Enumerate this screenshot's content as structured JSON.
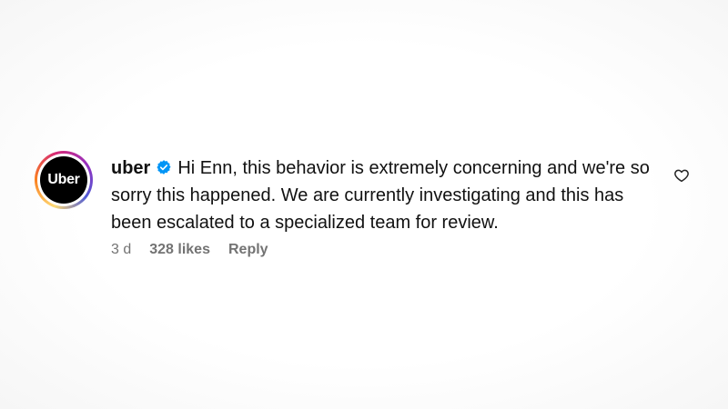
{
  "comment": {
    "avatar_text": "Uber",
    "username": "uber",
    "verified_icon": "verified-badge-icon",
    "body": "Hi Enn, this behavior is extremely concerning and we're so sorry this happened. We are currently investigating and this has been escalated to a specialized team for review.",
    "time_ago": "3 d",
    "likes": "328 likes",
    "reply_label": "Reply",
    "like_icon": "heart-icon"
  },
  "colors": {
    "verified": "#0095f6",
    "meta_text": "#737373",
    "avatar_bg": "#000000"
  }
}
